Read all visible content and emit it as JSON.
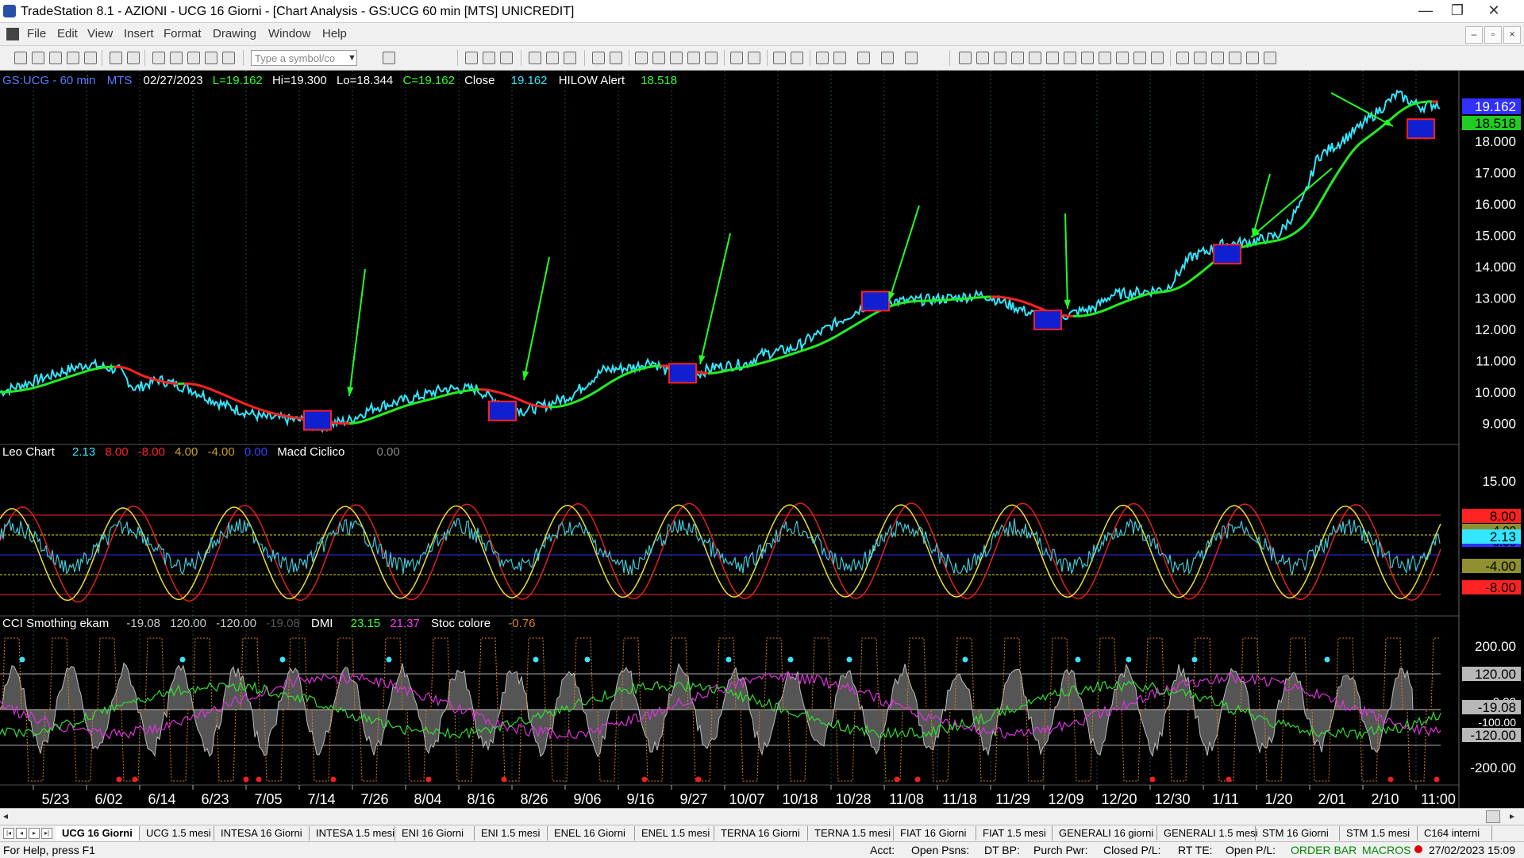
{
  "window": {
    "title": "TradeStation 8.1 - AZIONI - UCG 16 Giorni - [Chart Analysis - GS:UCG  60 min  [MTS] UNICREDIT]",
    "min": "—",
    "max": "❐",
    "close": "✕"
  },
  "menu": {
    "items": [
      "File",
      "Edit",
      "View",
      "Insert",
      "Format",
      "Drawing",
      "Window",
      "Help"
    ],
    "mdi": [
      "–",
      "▫",
      "×"
    ]
  },
  "toolbar": {
    "symbol_placeholder": "Type a symbol/co"
  },
  "chart": {
    "price_header": {
      "symbol": "GS:UCG - 60 min",
      "mts": "MTS",
      "date": "02/27/2023",
      "last": "L=19.162",
      "hi": "Hi=19.300",
      "lo": "Lo=18.344",
      "close": "C=19.162",
      "close_label": "Close",
      "close_value": "19.162",
      "alert_label": "HILOW Alert",
      "alert_value": "18.518"
    },
    "price_axis": {
      "ticks": [
        "18.000",
        "17.000",
        "16.000",
        "15.000",
        "14.000",
        "13.000",
        "12.000",
        "11.000",
        "10.000",
        "9.000"
      ],
      "badge_close": "19.162",
      "badge_alert": "18.518"
    },
    "leo_header": {
      "name": "Leo Chart",
      "v1": "2.13",
      "v2": "8.00",
      "v3": "-8.00",
      "v4": "4.00",
      "v5": "-4.00",
      "v6": "0.00",
      "macd_label": "Macd Ciclico",
      "macd_value": "0.00"
    },
    "leo_axis": {
      "tick": "15.00",
      "badges": [
        "8.00",
        "4.00",
        "2.13",
        "0.00",
        "-4.00",
        "-8.00"
      ]
    },
    "cci_header": {
      "name": "CCI Smothing ekam",
      "v1": "-19.08",
      "v2": "120.00",
      "v3": "-120.00",
      "v4": "-19.08",
      "dmi_label": "DMI",
      "dmi_plus": "23.15",
      "dmi_minus": "21.37",
      "stoc_label": "Stoc colore",
      "stoc_value": "-0.76"
    },
    "cci_axis": {
      "badges": [
        "200.00",
        "120.00",
        "0.00",
        "-19.08",
        "-100.00",
        "-120.00",
        "-200.00"
      ]
    },
    "date_axis": [
      "5/23",
      "6/02",
      "6/14",
      "6/23",
      "7/05",
      "7/14",
      "7/26",
      "8/04",
      "8/16",
      "8/26",
      "9/06",
      "9/16",
      "9/27",
      "10/07",
      "10/18",
      "10/28",
      "11/08",
      "11/18",
      "11/29",
      "12/09",
      "12/20",
      "12/30",
      "1/11",
      "1/20",
      "2/01",
      "2/10",
      "11:00"
    ],
    "colors": {
      "price": "#33e6ff",
      "avg_up": "#22ee22",
      "avg_down": "#ff2222",
      "arrow": "#22ff22",
      "box_border": "#ff2020",
      "box_fill": "#1020d0"
    }
  },
  "tabs": [
    "UCG 16 Giorni",
    "UCG 1.5 mesi",
    "INTESA 16 Giorni",
    "INTESA 1.5 mesi",
    "ENI 16 Giorni",
    "ENI 1.5 mesi",
    "ENEL 16 Giorni",
    "ENEL 1.5 mesi",
    "TERNA 16 Giorni",
    "TERNA 1.5 mesi",
    "FIAT 16 Giorni",
    "FIAT 1.5 mesi",
    "GENERALI 16 giorni",
    "GENERALI 1.5 mesi",
    "STM 16 Giorni",
    "STM 1.5 mesi",
    "C164 interni"
  ],
  "status": {
    "help": "For Help, press F1",
    "acct": "Acct:",
    "open_psns": "Open Psns:",
    "dt_bp": "DT BP:",
    "purch_pwr": "Purch Pwr:",
    "closed_pl": "Closed P/L:",
    "rt_te": "RT TE:",
    "open_pl": "Open P/L:",
    "order_bar": "ORDER BAR",
    "macros": "MACROS",
    "datetime": "27/02/2023 15:09"
  }
}
